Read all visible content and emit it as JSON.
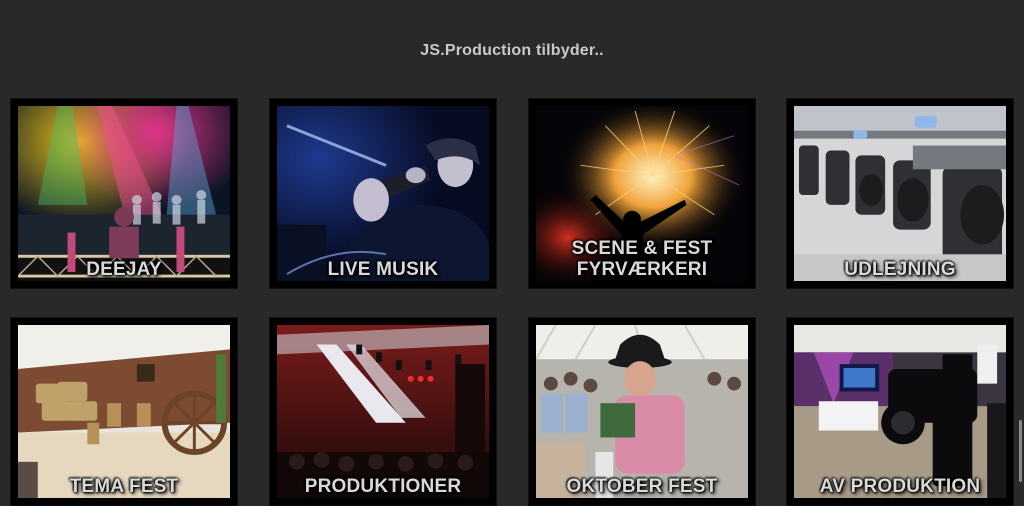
{
  "page": {
    "heading": "JS.Production tilbyder.."
  },
  "tiles": [
    {
      "caption_line1": "DEEJAY",
      "caption_line2": "",
      "image": "dj-stage-lights-photo"
    },
    {
      "caption_line1": "LIVE MUSIK",
      "caption_line2": "",
      "image": "saxophone-player-photo"
    },
    {
      "caption_line1": "SCENE & FEST",
      "caption_line2": "FYRVÆRKERI",
      "image": "fireworks-photo"
    },
    {
      "caption_line1": "UDLEJNING",
      "caption_line2": "",
      "image": "moving-head-lights-photo"
    },
    {
      "caption_line1": "TEMA FEST",
      "caption_line2": "",
      "image": "western-theme-party-photo"
    },
    {
      "caption_line1": "PRODUKTIONER",
      "caption_line2": "",
      "image": "stage-production-photo"
    },
    {
      "caption_line1": "OKTOBER FEST",
      "caption_line2": "",
      "image": "oktoberfest-photo"
    },
    {
      "caption_line1": "AV PRODUKTION",
      "caption_line2": "",
      "image": "av-camera-photo"
    }
  ],
  "colors": {
    "background": "#292929",
    "heading": "#c9c9c9",
    "caption": "#d9d9d9",
    "tile_frame": "#000000"
  }
}
